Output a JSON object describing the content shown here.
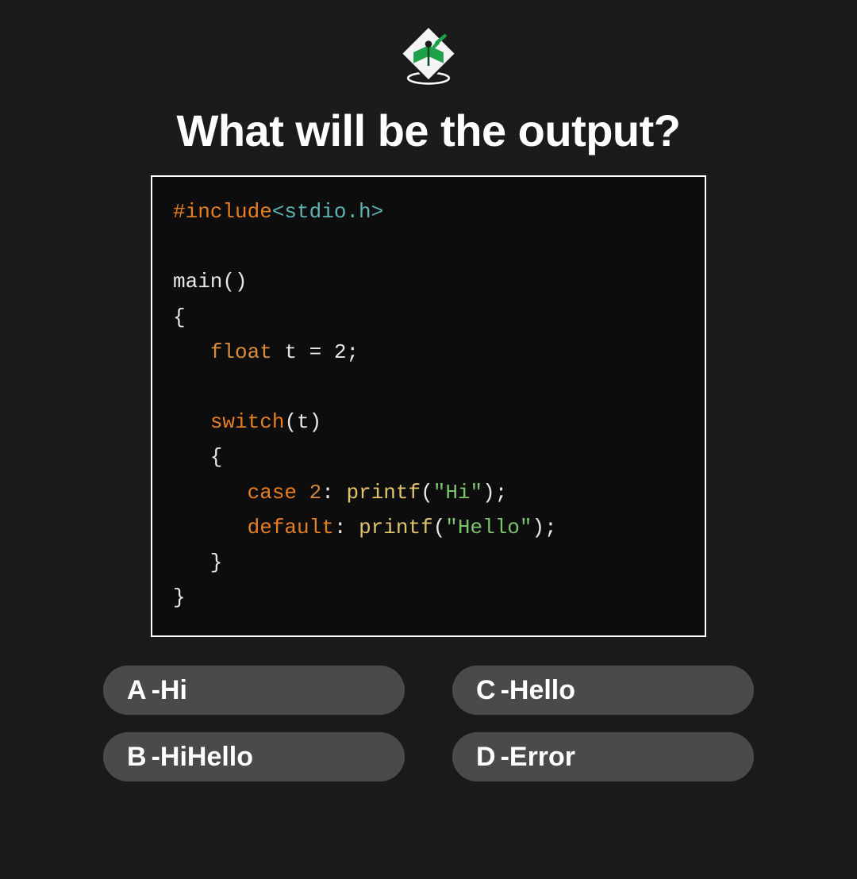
{
  "title": "What will be the output?",
  "code": {
    "l1_include": "#include",
    "l1_header": "<stdio.h>",
    "l3": "main()",
    "l4": "{",
    "l5_type": "float",
    "l5_rest": " t = 2;",
    "l7_switch": "switch",
    "l7_arg": "(t)",
    "l8": "   {",
    "l9_case": "case",
    "l9_num": " 2",
    "l9_colon": ": ",
    "l9_printf": "printf",
    "l9_paren_o": "(",
    "l9_str": "\"Hi\"",
    "l9_end": ");",
    "l10_default": "default",
    "l10_colon": ": ",
    "l10_printf": "printf",
    "l10_paren_o": "(",
    "l10_str": "\"Hello\"",
    "l10_end": ");",
    "l11": "   }",
    "l12": "}"
  },
  "answers": {
    "a": {
      "letter": "A",
      "sep": " - ",
      "text": "Hi"
    },
    "b": {
      "letter": "B",
      "sep": " - ",
      "text": "HiHello"
    },
    "c": {
      "letter": "C",
      "sep": " - ",
      "text": "Hello"
    },
    "d": {
      "letter": "D",
      "sep": " - ",
      "text": "Error"
    }
  }
}
